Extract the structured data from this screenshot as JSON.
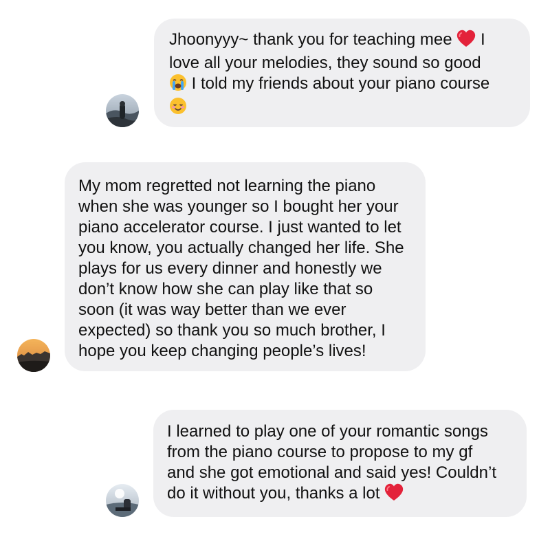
{
  "messages": [
    {
      "lines": [
        "Jhoonyyy~ thank you for teaching mee",
        "I",
        "love all your melodies, they sound so good",
        "I told my friends about your piano course"
      ],
      "emojis": [
        "red-heart",
        "loudly-crying-face",
        "smiling-face"
      ]
    },
    {
      "lines": [
        "My mom regretted not learning the piano",
        "when she was younger so I bought her your",
        "piano accelerator course. I just wanted to let",
        "you know, you actually changed her life. She",
        "plays for us every dinner and honestly we",
        "don’t know how she can play like that so",
        "soon (it was way better than we ever",
        "expected) so thank you so much brother, I",
        "hope you keep changing people’s lives!"
      ]
    },
    {
      "lines": [
        "I learned to play one of your romantic songs",
        "from the piano course to propose to my gf",
        "and she got emotional and said yes! Couldn’t",
        "do it without you, thanks a lot"
      ],
      "emojis": [
        "red-heart"
      ]
    }
  ],
  "colors": {
    "bubble": "#efeff1",
    "text": "#111111",
    "heart": "#e3223a"
  }
}
